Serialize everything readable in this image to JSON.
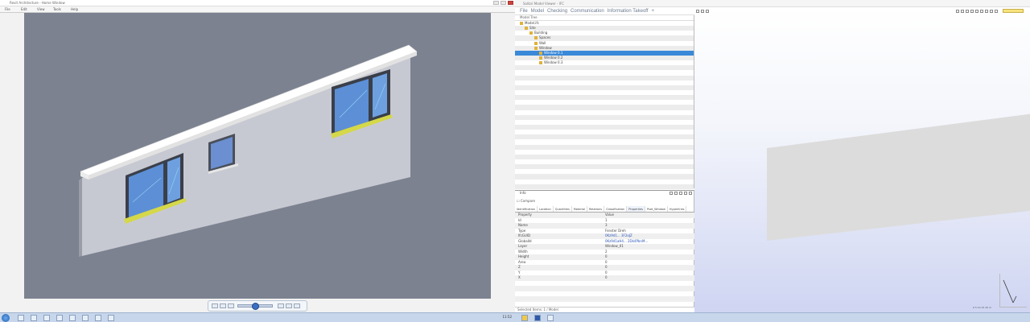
{
  "left_app": {
    "title": "Revit Architecture - Home Window",
    "menu": [
      "File",
      "Edit",
      "View",
      "Tools",
      "Help"
    ],
    "taskbar_clock": "11:52"
  },
  "right_app": {
    "title": "Solibri Model Viewer - IFC",
    "menu": [
      "File",
      "Model",
      "Checking",
      "Communication",
      "Information Takeoff",
      "+"
    ],
    "menu_colors": {
      "accent": "#6c7a90"
    },
    "tree_header": "Model Tree",
    "tree_rows": [
      {
        "label": "Model.ifc",
        "indent": 1,
        "selected": false
      },
      {
        "label": "Site",
        "indent": 2,
        "selected": false
      },
      {
        "label": "Building",
        "indent": 3,
        "selected": false
      },
      {
        "label": "Spaces",
        "indent": 4,
        "selected": false
      },
      {
        "label": "Wall",
        "indent": 4,
        "selected": false
      },
      {
        "label": "Window",
        "indent": 4,
        "selected": false
      },
      {
        "label": "Window 0.1",
        "indent": 5,
        "selected": true
      },
      {
        "label": "Window 0.2",
        "indent": 5,
        "selected": false
      },
      {
        "label": "Window 0.3",
        "indent": 5,
        "selected": false
      },
      {
        "label": "",
        "indent": 0,
        "selected": false
      },
      {
        "label": "",
        "indent": 0,
        "selected": false
      },
      {
        "label": "",
        "indent": 0,
        "selected": false
      },
      {
        "label": "",
        "indent": 0,
        "selected": false
      },
      {
        "label": "",
        "indent": 0,
        "selected": false
      },
      {
        "label": "",
        "indent": 0,
        "selected": false
      },
      {
        "label": "",
        "indent": 0,
        "selected": false
      },
      {
        "label": "",
        "indent": 0,
        "selected": false
      },
      {
        "label": "",
        "indent": 0,
        "selected": false
      },
      {
        "label": "",
        "indent": 0,
        "selected": false
      },
      {
        "label": "",
        "indent": 0,
        "selected": false
      },
      {
        "label": "",
        "indent": 0,
        "selected": false
      },
      {
        "label": "",
        "indent": 0,
        "selected": false
      },
      {
        "label": "",
        "indent": 0,
        "selected": false
      },
      {
        "label": "",
        "indent": 0,
        "selected": false
      },
      {
        "label": "",
        "indent": 0,
        "selected": false
      },
      {
        "label": "",
        "indent": 0,
        "selected": false
      },
      {
        "label": "",
        "indent": 0,
        "selected": false
      },
      {
        "label": "",
        "indent": 0,
        "selected": false
      },
      {
        "label": "",
        "indent": 0,
        "selected": false
      },
      {
        "label": "",
        "indent": 0,
        "selected": false
      },
      {
        "label": "",
        "indent": 0,
        "selected": false
      },
      {
        "label": "",
        "indent": 0,
        "selected": false
      },
      {
        "label": "",
        "indent": 0,
        "selected": false
      },
      {
        "label": "",
        "indent": 0,
        "selected": false
      }
    ],
    "props_header": "Info",
    "props_checkbox": "Compare",
    "props_tabs": [
      "Identification",
      "Location",
      "Quantities",
      "Material",
      "Relations",
      "Classification",
      "Properties",
      "Pset_Window",
      "Hyperlinks"
    ],
    "props_rows": [
      {
        "k": "Property",
        "v": "Value",
        "link": false
      },
      {
        "k": "Id",
        "v": "1",
        "link": false
      },
      {
        "k": "Name",
        "v": "3",
        "link": false
      },
      {
        "k": "Type",
        "v": "Fenster Dreh",
        "link": false
      },
      {
        "k": "IfcGUID",
        "v": "0Kz9d1... 3F2oJZ",
        "link": true
      },
      {
        "k": "GlobalId",
        "v": "0Kz9d1aH4... 2Dk4PbnM...",
        "link": true
      },
      {
        "k": "Layer",
        "v": "Window_01",
        "link": false
      },
      {
        "k": "Width",
        "v": "2",
        "link": false
      },
      {
        "k": "Height",
        "v": "0",
        "link": false
      },
      {
        "k": "Area",
        "v": "0",
        "link": false
      },
      {
        "k": "Z",
        "v": "0",
        "link": false
      },
      {
        "k": "Y",
        "v": "0",
        "link": false
      },
      {
        "k": "X",
        "v": "0",
        "link": false
      },
      {
        "k": "",
        "v": "",
        "link": false
      },
      {
        "k": "",
        "v": "",
        "link": false
      },
      {
        "k": "",
        "v": "",
        "link": false
      },
      {
        "k": "",
        "v": "",
        "link": false
      },
      {
        "k": "",
        "v": "",
        "link": false
      }
    ],
    "status": "Selected Items: 1 / Model",
    "scale_label": "0 5 10 15 20 m",
    "search_value": ""
  }
}
